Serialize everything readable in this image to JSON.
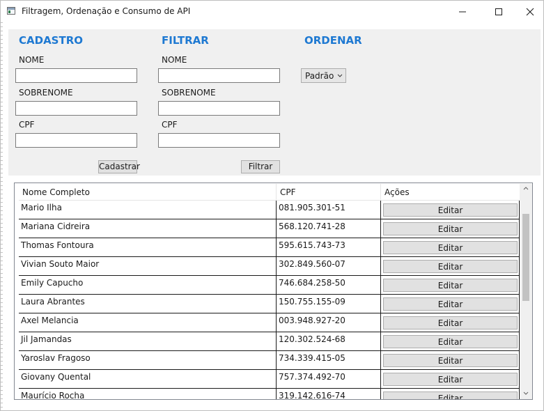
{
  "window": {
    "title": "Filtragem, Ordenação e Consumo de API"
  },
  "cadastro": {
    "title": "CADASTRO",
    "nome_label": "NOME",
    "nome_value": "",
    "sobrenome_label": "SOBRENOME",
    "sobrenome_value": "",
    "cpf_label": "CPF",
    "cpf_value": "",
    "button_label": "Cadastrar"
  },
  "filtrar": {
    "title": "FILTRAR",
    "nome_label": "NOME",
    "nome_value": "",
    "sobrenome_label": "SOBRENOME",
    "sobrenome_value": "",
    "cpf_label": "CPF",
    "cpf_value": "",
    "button_label": "Filtrar"
  },
  "ordenar": {
    "title": "ORDENAR",
    "selected": "Padrão"
  },
  "grid": {
    "headers": {
      "name": "Nome Completo",
      "cpf": "CPF",
      "actions": "Ações"
    },
    "edit_label": "Editar",
    "rows": [
      {
        "name": "Mario Ilha",
        "cpf": "081.905.301-51"
      },
      {
        "name": "Mariana Cidreira",
        "cpf": "568.120.741-28"
      },
      {
        "name": "Thomas Fontoura",
        "cpf": "595.615.743-73"
      },
      {
        "name": "Vivian Souto Maior",
        "cpf": "302.849.560-07"
      },
      {
        "name": "Emily Capucho",
        "cpf": "746.684.258-50"
      },
      {
        "name": "Laura Abrantes",
        "cpf": "150.755.155-09"
      },
      {
        "name": "Axel Melancia",
        "cpf": "003.948.927-20"
      },
      {
        "name": "Jil Jamandas",
        "cpf": "120.302.524-68"
      },
      {
        "name": "Yaroslav Fragoso",
        "cpf": "734.339.415-05"
      },
      {
        "name": "Giovany Quental",
        "cpf": "757.374.492-70"
      },
      {
        "name": "Maurício Rocha",
        "cpf": "319.142.616-74"
      }
    ]
  },
  "colors": {
    "section_title": "#1e79d2",
    "panel_bg": "#f0f0f0",
    "button_bg": "#e1e1e1"
  }
}
